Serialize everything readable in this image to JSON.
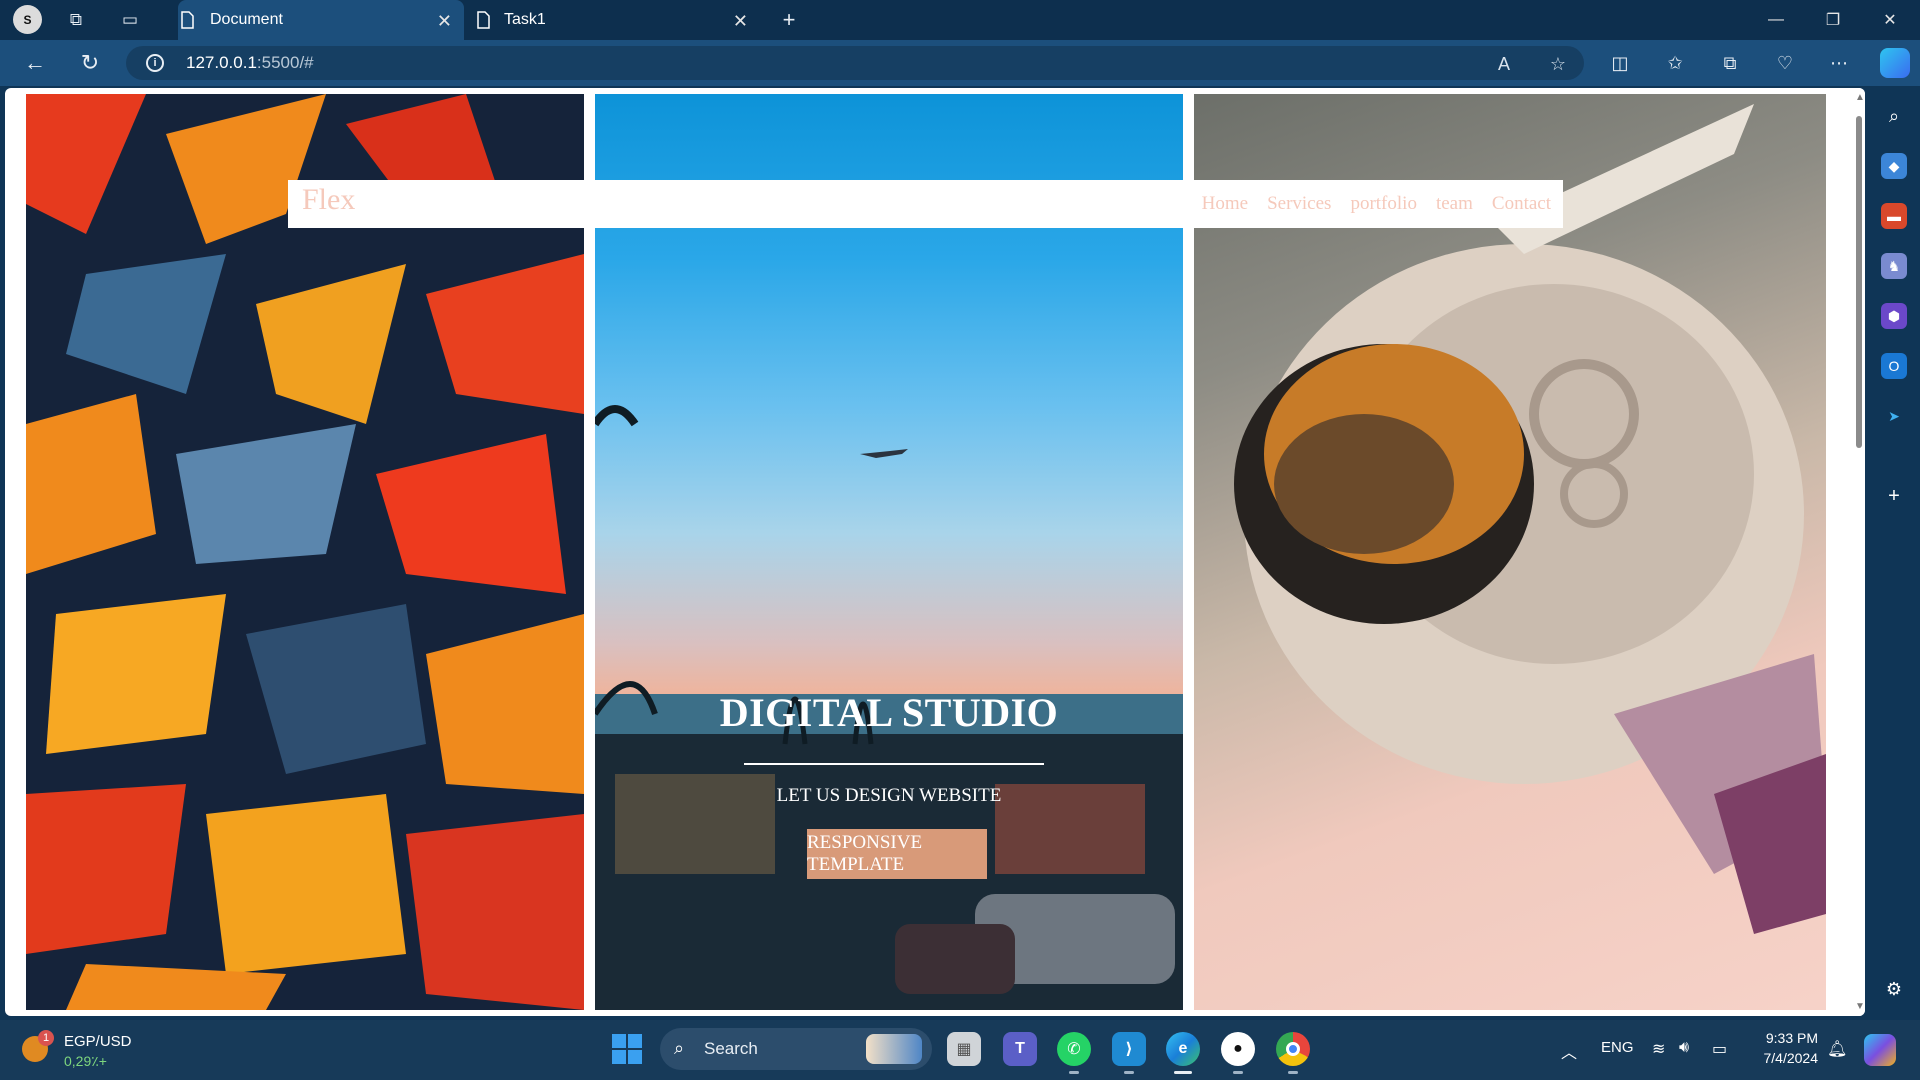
{
  "browser": {
    "profile_initial": "S",
    "tabs": [
      {
        "title": "Document",
        "active": true
      },
      {
        "title": "Task1",
        "active": false
      }
    ],
    "url_host": "127.0.0.1",
    "url_rest": ":5500/#"
  },
  "page": {
    "brand": "Flex",
    "nav_links": [
      "Home",
      "Services",
      "portfolio",
      "team",
      "Contact"
    ],
    "hero_title": "DIGITAL STUDIO",
    "hero_subtitle": "LET US DESIGN WEBSITE",
    "hero_button": "RESPONSIVE TEMPLATE",
    "colors": {
      "accent": "#d89a79",
      "nav_text": "#f5c9bb"
    }
  },
  "taskbar": {
    "widget_title": "EGP/USD",
    "widget_value": "0,29٪+",
    "widget_badge": "1",
    "search_label": "Search",
    "language": "ENG",
    "time": "9:33 PM",
    "date": "7/4/2024",
    "apps": [
      "file-explorer",
      "teams",
      "whatsapp",
      "vscode",
      "edge",
      "github",
      "chrome"
    ]
  }
}
